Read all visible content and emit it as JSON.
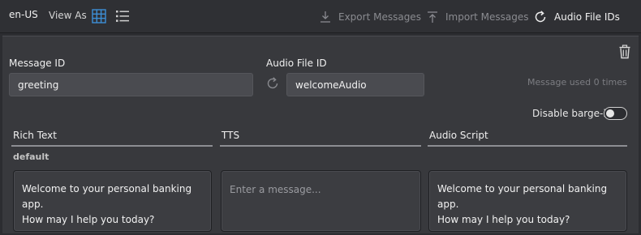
{
  "toolbar": {
    "locale": "en-US",
    "view_as_label": "View As",
    "export_label": "Export Messages",
    "import_label": "Import Messages",
    "audio_ids_label": "Audio File IDs"
  },
  "form": {
    "message_id_label": "Message ID",
    "message_id_value": "greeting",
    "audio_file_id_label": "Audio File ID",
    "audio_file_id_value": "welcomeAudio",
    "usage_text": "Message used 0 times",
    "barge_in_label": "Disable barge-in",
    "barge_in_enabled": false
  },
  "columns": {
    "rich_text": "Rich Text",
    "tts": "TTS",
    "audio_script": "Audio Script"
  },
  "variant": {
    "name": "default",
    "rich_text_line1": "Welcome to your personal banking app.",
    "rich_text_line2": "How may I help you today?",
    "tts_placeholder": "Enter a message...",
    "audio_script_line1": "Welcome to your personal banking app.",
    "audio_script_line2": "How may I help you today?"
  },
  "colors": {
    "background": "#2c2d31",
    "panel": "#38393d",
    "accent_blue": "#3d8fd6",
    "muted_text": "#8a8b90"
  },
  "icons": [
    "grid-view-icon",
    "list-view-icon",
    "download-icon",
    "upload-icon",
    "refresh-icon",
    "trash-icon"
  ]
}
